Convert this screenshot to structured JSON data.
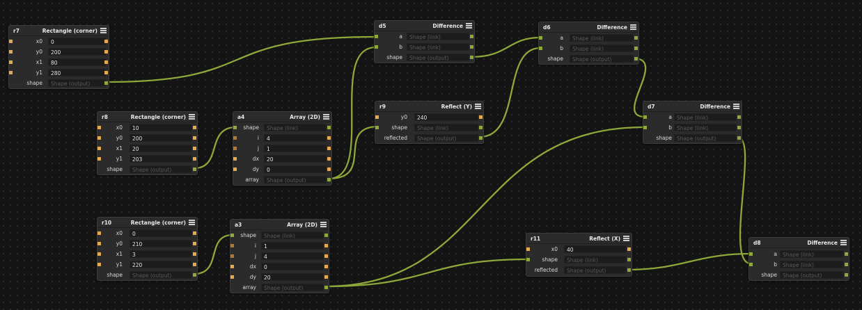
{
  "placeholders": {
    "link": "Shape (link)",
    "output": "Shape (output)"
  },
  "colors": {
    "canvas": "#141414",
    "node_bg": "#2b2b2b",
    "wire": "#8fa83a",
    "port_number": "#e6a94c",
    "port_shape": "#8fa83a"
  },
  "nodes": {
    "r7": {
      "id": "r7",
      "title": "Rectangle (corner)",
      "rows": [
        {
          "label": "x0",
          "value": "0"
        },
        {
          "label": "y0",
          "value": "200"
        },
        {
          "label": "x1",
          "value": "80"
        },
        {
          "label": "y1",
          "value": "280"
        },
        {
          "label": "shape",
          "value": "Shape (output)"
        }
      ]
    },
    "r8": {
      "id": "r8",
      "title": "Rectangle (corner)",
      "rows": [
        {
          "label": "x0",
          "value": "10"
        },
        {
          "label": "y0",
          "value": "200"
        },
        {
          "label": "x1",
          "value": "20"
        },
        {
          "label": "y1",
          "value": "203"
        },
        {
          "label": "shape",
          "value": "Shape (output)"
        }
      ]
    },
    "r10": {
      "id": "r10",
      "title": "Rectangle (corner)",
      "rows": [
        {
          "label": "x0",
          "value": "0"
        },
        {
          "label": "y0",
          "value": "210"
        },
        {
          "label": "x1",
          "value": "3"
        },
        {
          "label": "y1",
          "value": "220"
        },
        {
          "label": "shape",
          "value": "Shape (output)"
        }
      ]
    },
    "a4": {
      "id": "a4",
      "title": "Array (2D)",
      "rows": [
        {
          "label": "shape",
          "value": "Shape (link)"
        },
        {
          "label": "i",
          "value": "4"
        },
        {
          "label": "j",
          "value": "1"
        },
        {
          "label": "dx",
          "value": "20"
        },
        {
          "label": "dy",
          "value": "0"
        },
        {
          "label": "array",
          "value": "Shape (output)"
        }
      ]
    },
    "a3": {
      "id": "a3",
      "title": "Array (2D)",
      "rows": [
        {
          "label": "shape",
          "value": "Shape (link)"
        },
        {
          "label": "i",
          "value": "1"
        },
        {
          "label": "j",
          "value": "4"
        },
        {
          "label": "dx",
          "value": "0"
        },
        {
          "label": "dy",
          "value": "20"
        },
        {
          "label": "array",
          "value": "Shape (output)"
        }
      ]
    },
    "d5": {
      "id": "d5",
      "title": "Difference",
      "rows": [
        {
          "label": "a",
          "value": "Shape (link)"
        },
        {
          "label": "b",
          "value": "Shape (link)"
        },
        {
          "label": "shape",
          "value": "Shape (output)"
        }
      ]
    },
    "d6": {
      "id": "d6",
      "title": "Difference",
      "rows": [
        {
          "label": "a",
          "value": "Shape (link)"
        },
        {
          "label": "b",
          "value": "Shape (link)"
        },
        {
          "label": "shape",
          "value": "Shape (output)"
        }
      ]
    },
    "d7": {
      "id": "d7",
      "title": "Difference",
      "rows": [
        {
          "label": "a",
          "value": "Shape (link)"
        },
        {
          "label": "b",
          "value": "Shape (link)"
        },
        {
          "label": "shape",
          "value": "Shape (output)"
        }
      ]
    },
    "d8": {
      "id": "d8",
      "title": "Difference",
      "rows": [
        {
          "label": "a",
          "value": "Shape (link)"
        },
        {
          "label": "b",
          "value": "Shape (link)"
        },
        {
          "label": "shape",
          "value": "Shape (output)"
        }
      ]
    },
    "r9": {
      "id": "r9",
      "title": "Reflect (Y)",
      "rows": [
        {
          "label": "y0",
          "value": "240"
        },
        {
          "label": "shape",
          "value": "Shape (link)"
        },
        {
          "label": "reflected",
          "value": "Shape (output)"
        }
      ]
    },
    "r11": {
      "id": "r11",
      "title": "Reflect (X)",
      "rows": [
        {
          "label": "x0",
          "value": "40"
        },
        {
          "label": "shape",
          "value": "Shape (link)"
        },
        {
          "label": "reflected",
          "value": "Shape (output)"
        }
      ]
    }
  }
}
